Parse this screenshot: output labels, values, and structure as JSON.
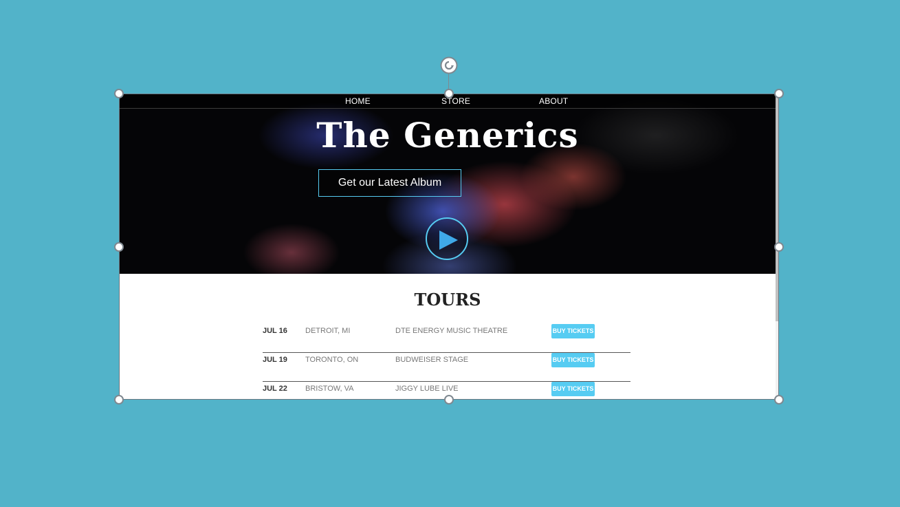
{
  "nav": {
    "home": "HOME",
    "store": "STORE",
    "about": "ABOUT"
  },
  "hero": {
    "title": "The Generics",
    "album_button": "Get our Latest Album",
    "play_icon": "play-icon"
  },
  "tours": {
    "title": "TOURS",
    "rows": [
      {
        "date": "JUL 16",
        "city": "DETROIT, MI",
        "venue": "DTE ENERGY MUSIC THEATRE",
        "button": "BUY TICKETS"
      },
      {
        "date": "JUL 19",
        "city": "TORONTO, ON",
        "venue": "BUDWEISER STAGE",
        "button": "BUY TICKETS"
      },
      {
        "date": "JUL 22",
        "city": "BRISTOW, VA",
        "venue": "JIGGY LUBE LIVE",
        "button": "BUY TICKETS"
      }
    ]
  },
  "colors": {
    "background": "#52b3c9",
    "accent": "#56ccf2",
    "hero_dark": "#050507"
  },
  "icons": {
    "rotate": "rotate-icon"
  }
}
